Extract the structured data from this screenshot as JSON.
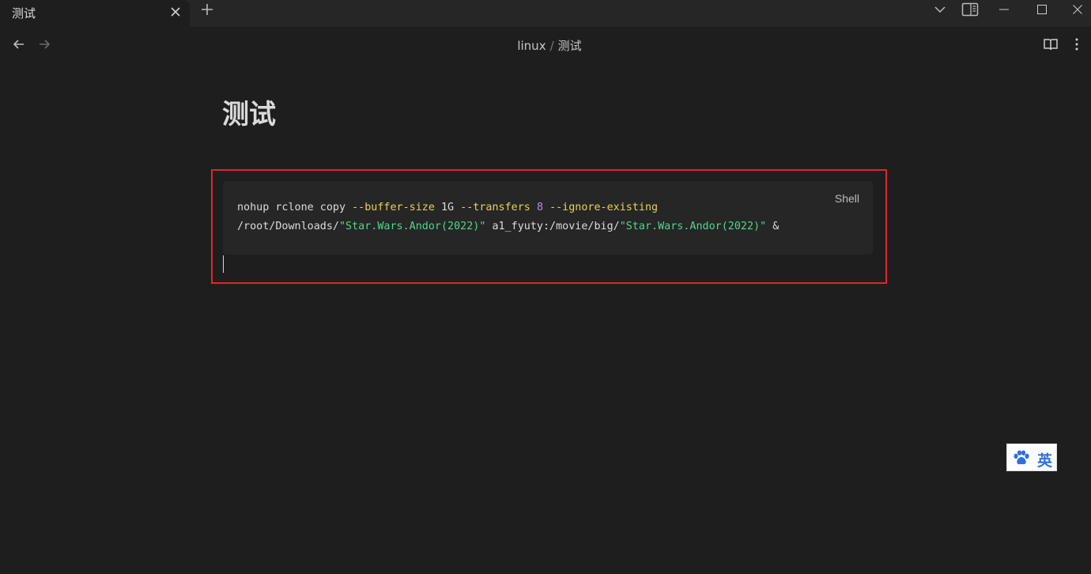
{
  "window": {
    "tab_title": "测试",
    "icons": [
      "close-icon",
      "plus-icon",
      "chevron-down-icon",
      "sidebar-toggle-icon",
      "minimize-icon",
      "maximize-icon",
      "window-close-icon"
    ]
  },
  "nav": {
    "breadcrumb": [
      "linux",
      "测试"
    ],
    "separator": "/",
    "icons": [
      "arrow-left-icon",
      "arrow-right-icon",
      "book-open-icon",
      "more-vertical-icon"
    ]
  },
  "document": {
    "title": "测试",
    "code_block": {
      "language": "Shell",
      "line1": {
        "cmd": "nohup rclone copy ",
        "flag1": "--buffer-size",
        "arg1": " 1G ",
        "flag2": "--transfers",
        "sp1": " ",
        "num": "8",
        "sp2": " ",
        "flag3": "--ignore-existing"
      },
      "line2": {
        "path1": "/root/Downloads/",
        "str1": "\"Star.Wars.Andor(2022)\"",
        "mid": " a1_fyuty:/movie/big/",
        "str2": "\"Star.Wars.Andor(2022)\"",
        "tail": " &"
      }
    }
  },
  "ime": {
    "language": "英",
    "icon": "paw-icon",
    "accent": "#2f6fe0"
  },
  "colors": {
    "background": "#1e1e1e",
    "highlight_border": "#e3242b",
    "flag": "#e5d35b",
    "number": "#b98ce8",
    "string": "#4fd88a"
  }
}
